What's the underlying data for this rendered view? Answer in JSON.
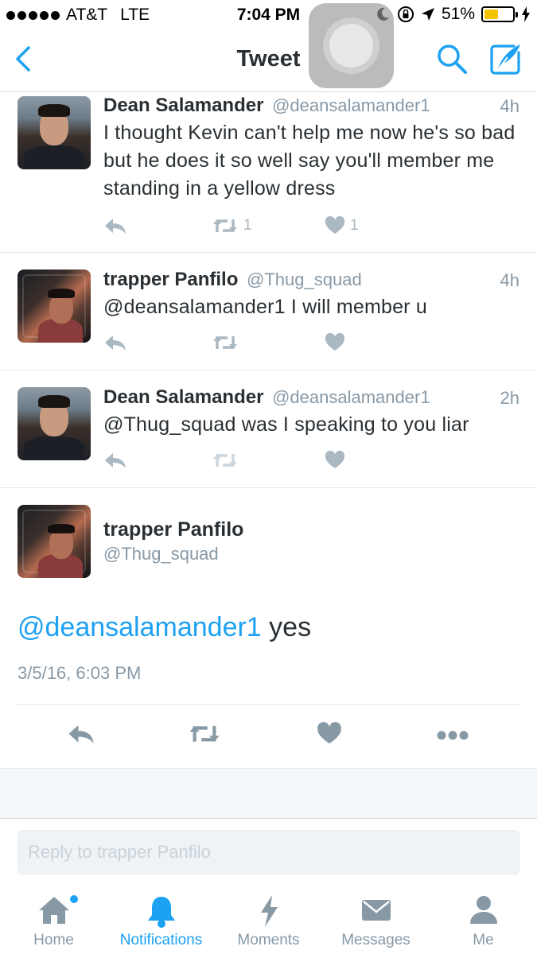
{
  "status_bar": {
    "carrier": "AT&T",
    "network": "LTE",
    "time": "7:04 PM",
    "battery": "51%",
    "battery_level": 0.51,
    "battery_color": "#f5c400"
  },
  "nav": {
    "title": "Tweet",
    "back_icon": "chevron-left-icon",
    "search_icon": "search-icon",
    "compose_icon": "compose-tweet-icon"
  },
  "colors": {
    "accent": "#1da1f2",
    "secondary_text": "#8899a6",
    "action_icons": "#aab8c2"
  },
  "replies": [
    {
      "name": "Dean Salamander",
      "handle": "@deansalamander1",
      "time": "4h",
      "text": "I thought Kevin can't help me now he's so bad but he does it so well say you'll member me standing in a yellow dress",
      "retweets": "1",
      "likes": "1"
    },
    {
      "name": "trapper Panfilo",
      "handle": "@Thug_squad",
      "time": "4h",
      "text": "@deansalamander1 I will member u",
      "retweets": "",
      "likes": ""
    },
    {
      "name": "Dean Salamander",
      "handle": "@deansalamander1",
      "time": "2h",
      "text": "@Thug_squad was I speaking to you liar",
      "retweets": "",
      "likes": ""
    }
  ],
  "main_tweet": {
    "name": "trapper Panfilo",
    "handle": "@Thug_squad",
    "mention": "@deansalamander1",
    "text": " yes",
    "date": "3/5/16, 6:03 PM"
  },
  "reply_box": {
    "placeholder": "Reply to trapper Panfilo"
  },
  "tabs": [
    {
      "label": "Home",
      "icon": "home-icon",
      "active": false
    },
    {
      "label": "Notifications",
      "icon": "bell-icon",
      "active": true
    },
    {
      "label": "Moments",
      "icon": "lightning-icon",
      "active": false
    },
    {
      "label": "Messages",
      "icon": "envelope-icon",
      "active": false
    },
    {
      "label": "Me",
      "icon": "person-icon",
      "active": false
    }
  ]
}
